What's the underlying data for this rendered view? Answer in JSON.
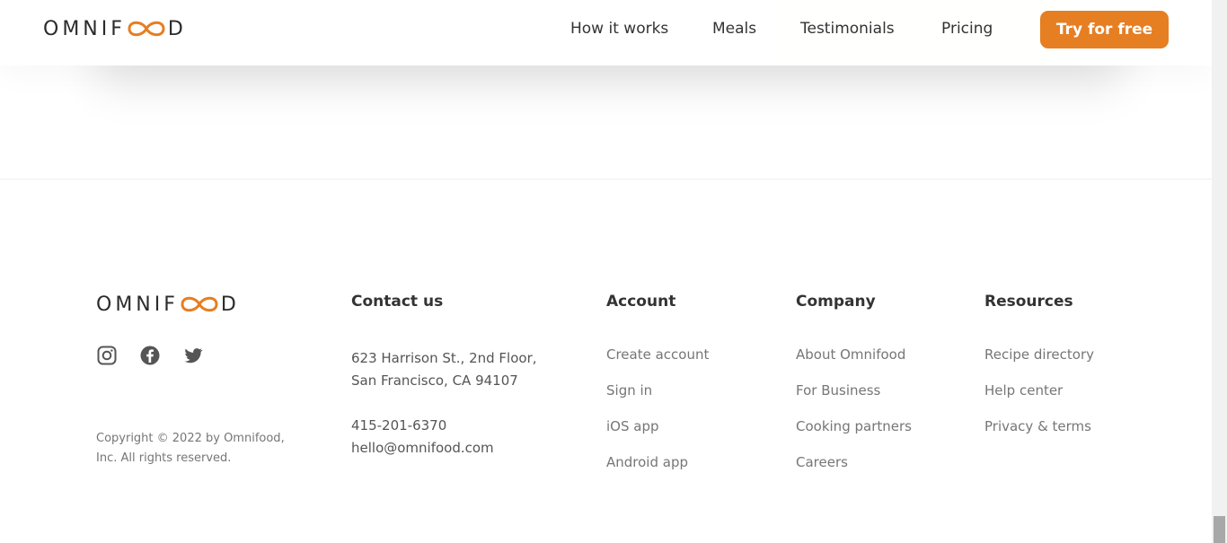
{
  "brand": {
    "logo_text_left": "OMNIF",
    "logo_text_right": "D",
    "accent": "#e67e22",
    "bg_tint": "#fdf2e9"
  },
  "header": {
    "nav": [
      {
        "label": "How it works"
      },
      {
        "label": "Meals"
      },
      {
        "label": "Testimonials"
      },
      {
        "label": "Pricing"
      }
    ],
    "cta_label": "Try for free"
  },
  "footer": {
    "social_icons": [
      "instagram-icon",
      "facebook-icon",
      "twitter-icon"
    ],
    "copyright_line1": "Copyright © 2022 by Omnifood,",
    "copyright_line2": "Inc. All rights reserved.",
    "contact": {
      "heading": "Contact us",
      "address_line1": "623 Harrison St., 2nd Floor,",
      "address_line2": "San Francisco, CA 94107",
      "phone": "415-201-6370",
      "email": "hello@omnifood.com"
    },
    "account": {
      "heading": "Account",
      "links": [
        "Create account",
        "Sign in",
        "iOS app",
        "Android app"
      ]
    },
    "company": {
      "heading": "Company",
      "links": [
        "About Omnifood",
        "For Business",
        "Cooking partners",
        "Careers"
      ]
    },
    "resources": {
      "heading": "Resources",
      "links": [
        "Recipe directory",
        "Help center",
        "Privacy & terms"
      ]
    }
  }
}
